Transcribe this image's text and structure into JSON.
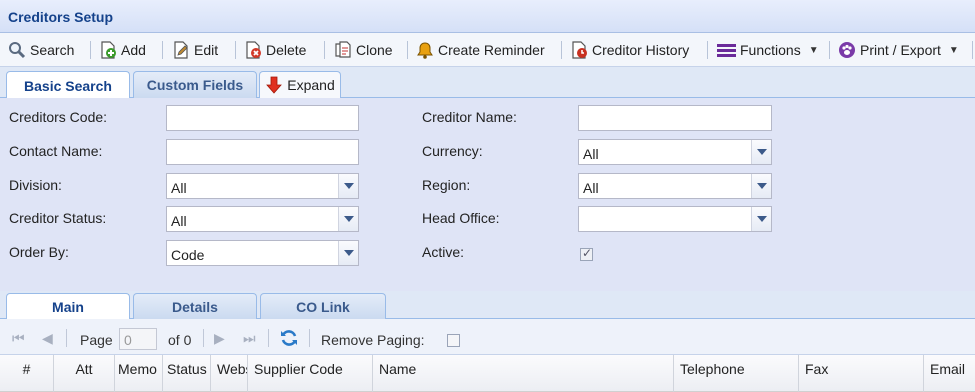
{
  "title": "Creditors Setup",
  "toolbar": {
    "search": "Search",
    "add": "Add",
    "edit": "Edit",
    "delete": "Delete",
    "clone": "Clone",
    "create_reminder": "Create Reminder",
    "creditor_history": "Creditor History",
    "functions": "Functions",
    "print_export": "Print / Export"
  },
  "search_tabs": {
    "basic": "Basic Search",
    "custom": "Custom Fields",
    "expand": "Expand"
  },
  "form": {
    "creditors_code": "Creditors Code:",
    "contact_name": "Contact Name:",
    "division": "Division:",
    "division_value": "All",
    "creditor_status": "Creditor Status:",
    "creditor_status_value": "All",
    "order_by": "Order By:",
    "order_by_value": "Code",
    "creditor_name": "Creditor Name:",
    "currency": "Currency:",
    "currency_value": "All",
    "region": "Region:",
    "region_value": "All",
    "head_office": "Head Office:",
    "head_office_value": "",
    "active": "Active:",
    "active_checked": true
  },
  "bottom_tabs": {
    "main": "Main",
    "details": "Details",
    "co_link": "CO Link"
  },
  "pager": {
    "page_label": "Page",
    "page_value": "0",
    "of_label": "of 0",
    "remove_paging": "Remove Paging:"
  },
  "columns": [
    "#",
    "Att",
    "Memo",
    "Status",
    "Webs",
    "Supplier Code",
    "Name",
    "Telephone",
    "Fax",
    "Email"
  ],
  "colors": {
    "title": "#15428b",
    "panel": "#dfe4f6",
    "tab_border": "#99bbe8"
  }
}
